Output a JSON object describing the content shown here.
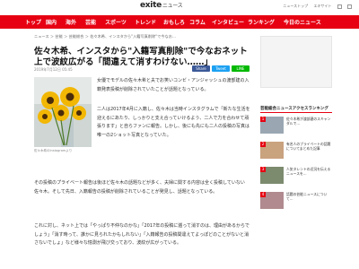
{
  "header": {
    "logo_main": "exite",
    "logo_news": "ニュース",
    "links": [
      "ニューストップ",
      "エキサイト"
    ]
  },
  "nav": {
    "items": [
      "トップ",
      "国内",
      "海外",
      "芸能",
      "スポーツ",
      "トレンド",
      "おもしろ",
      "コラム",
      "インタビュー",
      "ランキング",
      "今日のニュース"
    ]
  },
  "breadcrumb": "ニュース ＞ 芸能 ＞ 芸能総合 ＞ 佐々木希、インスタから\"入籍写真削除\"で今なお…",
  "article": {
    "title": "佐々木希、インスタから\"入籍写真削除\"で今なおネット上で波紋広がる「間違えて消すわけない……」",
    "date": "2019年7月12日 05:45",
    "share_labels": [
      "Share",
      "Tweet",
      "LINE"
    ],
    "photo_caption": "佐々木希のInstagramより",
    "paragraphs": [
      "女優でモデルの佐々木希と夫でお笑いコンビ・アンジャッシュの渡部建の入籍発表投稿が削除されていたことが話題となっている。",
      "二人は2017年4月に入籍し、佐々木は当時インスタグラムで「新たな生活を迎えるにあたり、しっかりと支え合っていけるよう、二人で力を合わせて頑張ります」と自らファンに報告。しかし、後にも先にも二人の投稿の写真は唯一の2ショット写真となっていた。",
      "その投稿のプライベート報告は後ほど佐々木の話題などが多く、夫婦に関する内容は全く投稿していない佐々木。そして先日、入籍報告の投稿が削除されていることが発見し、話題となっている。",
      "これに対し、ネット上では「やっぱり不仲なのかな」「2017年の投稿に遡って消すのは、理由があるからでしょう」「消す時って、誰かに見られたかもしれない」「入籍報告の投稿間違えてよっぽどのことがないと消さないでしょ」など様々な憶測が飛び交っており、波紋が広がっている。"
    ]
  },
  "sidebar": {
    "ranking_title": "芸能総合ニュースアクセスランキング",
    "items": [
      {
        "rank": "1",
        "text": "佐々木希が渡部建のスキャンダルで…"
      },
      {
        "rank": "2",
        "text": "有名人のプライベートの話題についてまとめた記事"
      },
      {
        "rank": "3",
        "text": "人気タレントの近況を伝えるニュースを…"
      },
      {
        "rank": "4",
        "text": "話題の芸能ニュースについて…"
      }
    ]
  },
  "colors": {
    "brand_red": "#e60012",
    "share_fb": "#3b5998",
    "share_tw": "#1da1f2",
    "share_line": "#00b900"
  }
}
